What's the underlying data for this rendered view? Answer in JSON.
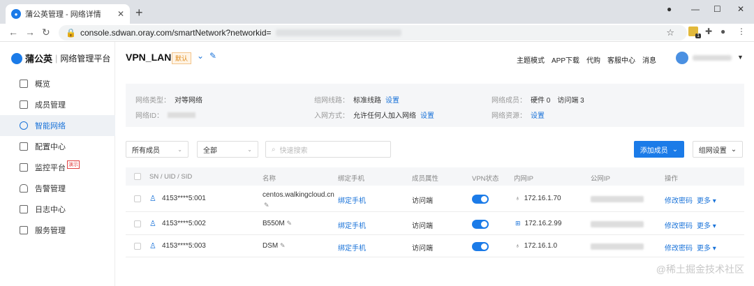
{
  "browser": {
    "tab_title": "蒲公英管理 - 网络详情",
    "url_prefix": "console.sdwan.oray.com/smartNetwork?networkid=",
    "close": "✕",
    "new_tab": "+"
  },
  "sidebar": {
    "logo_name": "蒲公英",
    "logo_sep": "|",
    "logo_sub": "网络管理平台",
    "items": [
      {
        "label": "概览"
      },
      {
        "label": "成员管理"
      },
      {
        "label": "智能网络"
      },
      {
        "label": "配置中心"
      },
      {
        "label": "监控平台"
      },
      {
        "label": "告警管理"
      },
      {
        "label": "日志中心"
      },
      {
        "label": "服务管理"
      }
    ],
    "demo_tag": "演示"
  },
  "header": {
    "title": "VPN_LAN",
    "badge": "默认",
    "topnav": [
      "主题模式",
      "APP下载",
      "代购",
      "客服中心",
      "消息"
    ]
  },
  "info": {
    "net_type_label": "网络类型：",
    "net_type_value": "对等网络",
    "net_id_label": "网络ID：",
    "line_label": "组网线路：",
    "line_value": "标准线路",
    "line_link": "设置",
    "join_label": "入网方式：",
    "join_value": "允许任何人加入网络",
    "join_link": "设置",
    "members_label": "网络成员：",
    "members_hw": "硬件 0",
    "members_access": "访问端 3",
    "res_label": "网络资源：",
    "res_link": "设置"
  },
  "filters": {
    "member_select": "所有成员",
    "all_select": "全部",
    "search_placeholder": "快速搜索",
    "add_member": "添加成员",
    "net_settings": "组网设置"
  },
  "table": {
    "headers": [
      "SN / UID / SID",
      "名称",
      "绑定手机",
      "成员属性",
      "VPN状态",
      "内网IP",
      "公网IP",
      "操作"
    ],
    "rows": [
      {
        "sn": "4153****5:001",
        "name": "centos.walkingcloud.cn",
        "phone": "绑定手机",
        "attr": "访问端",
        "ip": "172.16.1.70",
        "action": "修改密码",
        "more": "更多"
      },
      {
        "sn": "4153****5:002",
        "name": "B550M",
        "phone": "绑定手机",
        "attr": "访问端",
        "ip": "172.16.2.99",
        "action": "修改密码",
        "more": "更多"
      },
      {
        "sn": "4153****5:003",
        "name": "DSM",
        "phone": "绑定手机",
        "attr": "访问端",
        "ip": "172.16.1.0",
        "action": "修改密码",
        "more": "更多"
      }
    ]
  },
  "watermark": "@稀土掘金技术社区"
}
